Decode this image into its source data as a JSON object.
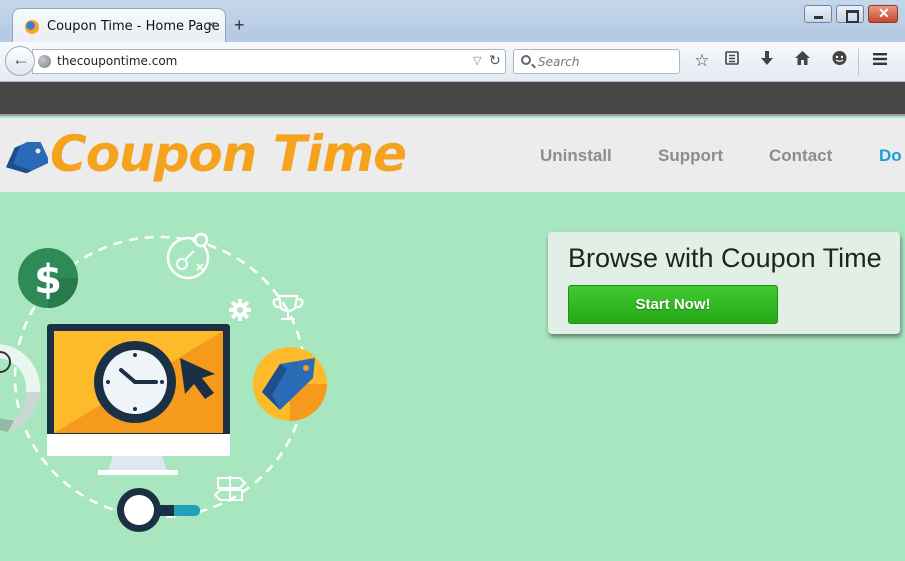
{
  "browser": {
    "tab_title": "Coupon Time - Home Page",
    "tab_close": "×",
    "new_tab": "+",
    "url": "thecoupontime.com",
    "url_dropdown": "▽",
    "reload": "↻",
    "search_placeholder": "Search",
    "icons": [
      "back-icon",
      "globe-icon",
      "search-icon",
      "bookmark-star-icon",
      "reading-list-icon",
      "download-icon",
      "home-icon",
      "chat-icon",
      "menu-icon"
    ]
  },
  "site": {
    "logo": "Coupon Time",
    "nav": {
      "uninstall": "Uninstall",
      "support": "Support",
      "contact": "Contact",
      "download": "Do"
    }
  },
  "cta": {
    "heading": "Browse with Coupon Time",
    "button": "Start Now!"
  },
  "colors": {
    "hero_bg": "#a8e6c0",
    "logo_orange": "#f5a21f",
    "cta_green": "#2fb51f",
    "nav_gray": "#8d8d8d",
    "nav_blue": "#1a9ed8",
    "dark_strip": "#464646"
  }
}
